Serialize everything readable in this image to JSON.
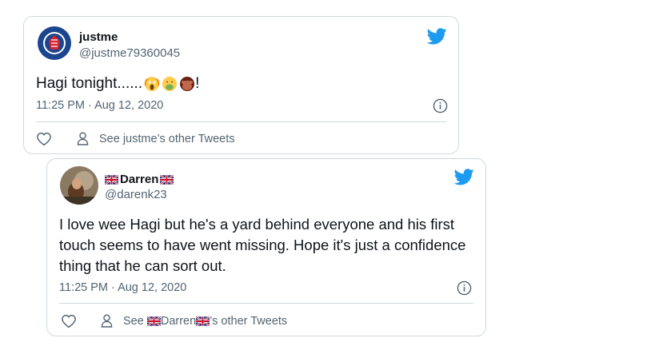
{
  "tweet1": {
    "display_name": "justme",
    "handle": "@justme79360045",
    "text": "Hagi tonight......",
    "text_suffix": "!",
    "emojis": [
      "scream-emoji",
      "nauseated-emoji",
      "see-no-evil-monkey-emoji"
    ],
    "timestamp": "11:25 PM · Aug 12, 2020",
    "other_tweets_label": "See justme’s other Tweets",
    "avatar": "rangers-football-club-crest"
  },
  "tweet2": {
    "display_name": "Darren",
    "handle": "@darenk23",
    "text": "I love wee Hagi but he's a yard behind everyone and his first touch seems to have went missing. Hope it's just a confidence thing that he can sort out.",
    "timestamp": "11:25 PM · Aug 12, 2020",
    "other_tweets_prefix": "See ",
    "other_tweets_name": "Darren",
    "other_tweets_suffix": "’s other Tweets",
    "name_decoration": "uk-flag-icon",
    "avatar": "user-photo"
  },
  "colors": {
    "twitter_blue": "#1d9bf0",
    "text_primary": "#0f1419",
    "text_secondary": "#536471",
    "border": "#cfd9de"
  }
}
